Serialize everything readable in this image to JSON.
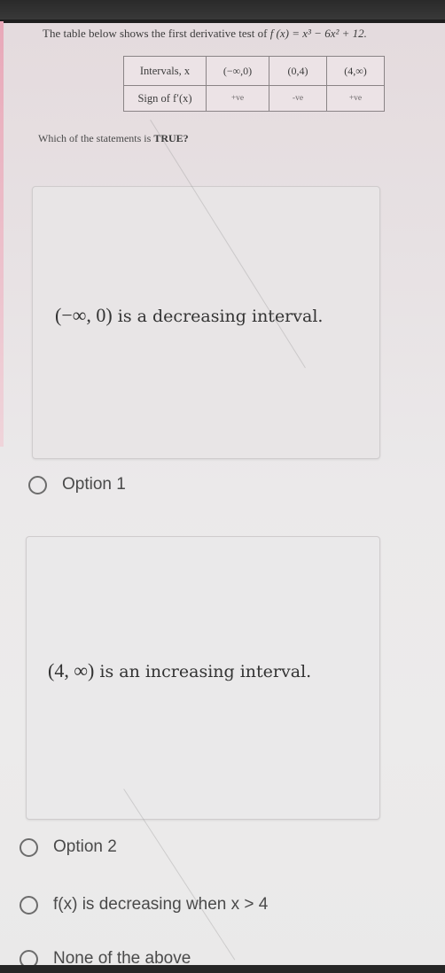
{
  "question": {
    "intro": "The table below shows the first derivative test of",
    "function_label": "f (x) = x³ − 6x² + 12.",
    "table": {
      "header_label": "Intervals, x",
      "row_label": "Sign of f′(x)",
      "intervals": [
        "(−∞,0)",
        "(0,4)",
        "(4,∞)"
      ],
      "signs": [
        "+ve",
        "-ve",
        "+ve"
      ]
    },
    "prompt_prefix": "Which of the statements is ",
    "prompt_emphasis": "TRUE?"
  },
  "cards": [
    {
      "math": "(−∞, 0)",
      "text": " is a decreasing interval."
    },
    {
      "math": "(4, ∞)",
      "text": " is an increasing interval."
    }
  ],
  "options": [
    {
      "label": "Option 1",
      "selected": false
    },
    {
      "label": "Option 2",
      "selected": false
    },
    {
      "label": "f(x) is decreasing when x > 4",
      "selected": false
    },
    {
      "label": "None of the above",
      "selected": false
    }
  ]
}
